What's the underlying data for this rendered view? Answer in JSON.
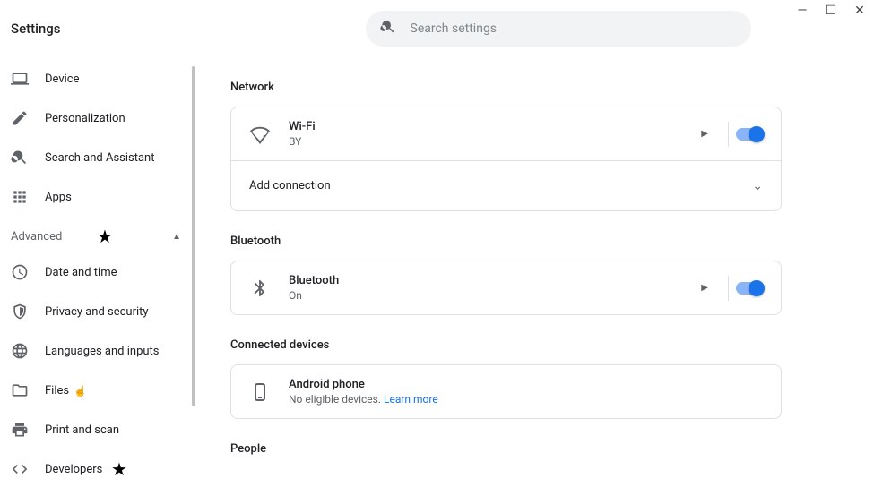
{
  "window": {
    "title": "Settings"
  },
  "search": {
    "placeholder": "Search settings"
  },
  "sidebar": {
    "items": {
      "device": "Device",
      "personalization": "Personalization",
      "searchAssistant": "Search and Assistant",
      "apps": "Apps",
      "dateTime": "Date and time",
      "privacySecurity": "Privacy and security",
      "languagesInputs": "Languages and inputs",
      "files": "Files",
      "printScan": "Print and scan",
      "developers": "Developers"
    },
    "advancedLabel": "Advanced"
  },
  "sections": {
    "network": {
      "title": "Network",
      "wifi": {
        "label": "Wi-Fi",
        "sub": "BY",
        "enabled": true
      },
      "addConnection": "Add connection"
    },
    "bluetooth": {
      "title": "Bluetooth",
      "row": {
        "label": "Bluetooth",
        "sub": "On",
        "enabled": true
      }
    },
    "connectedDevices": {
      "title": "Connected devices",
      "android": {
        "label": "Android phone",
        "sub": "No eligible devices. ",
        "link": "Learn more"
      }
    },
    "people": {
      "title": "People"
    }
  }
}
